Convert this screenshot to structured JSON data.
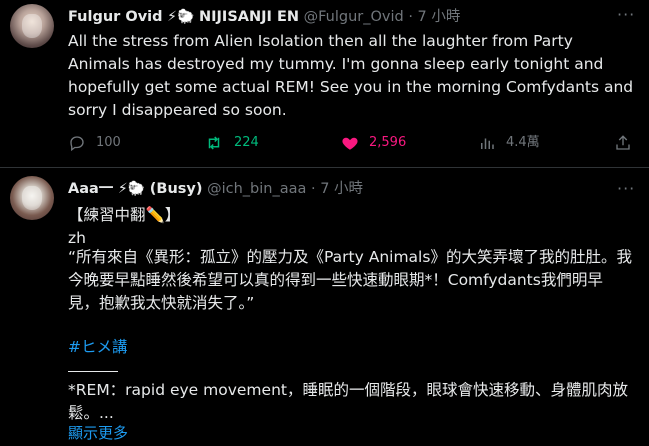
{
  "tweet1": {
    "name": "Fulgur Ovid",
    "badges": "⚡🐑",
    "org": "NIJISANJI EN",
    "handle": "@Fulgur_Ovid",
    "dot": "·",
    "time": "7 小時",
    "text": "All the stress from Alien Isolation then all the laughter from Party Animals has destroyed my tummy. I'm gonna sleep early tonight and hopefully get some actual REM! See you in the morning Comfydants and sorry I disappeared so soon.",
    "replies": "100",
    "retweets": "224",
    "likes": "2,596",
    "views": "4.4萬"
  },
  "tweet2": {
    "name": "Aaa一",
    "badges": "⚡🐑",
    "status": "(Busy)",
    "handle": "@ich_bin_aaa",
    "dot": "·",
    "time": "7 小時",
    "line1": "【練習中翻✏️】",
    "line2": "zh",
    "quote": "“所有來自《異形：孤立》的壓力及《Party Animals》的大笑弄壞了我的肚肚。我今晚要早點睡然後希望可以真的得到一些快速動眼期*！Comfydants我們明早見，抱歉我太快就消失了。”",
    "hashtag": "#ヒメ講",
    "note": "*REM：rapid eye movement，睡眠的一個階段，眼球會快速移動、身體肌肉放鬆。...",
    "show_more": "顯示更多"
  },
  "colors": {
    "background": "#000000",
    "text": "#e7e9ea",
    "muted": "#71767b",
    "link": "#1d9bf0",
    "retweet": "#00ba7c",
    "like": "#f91880"
  }
}
